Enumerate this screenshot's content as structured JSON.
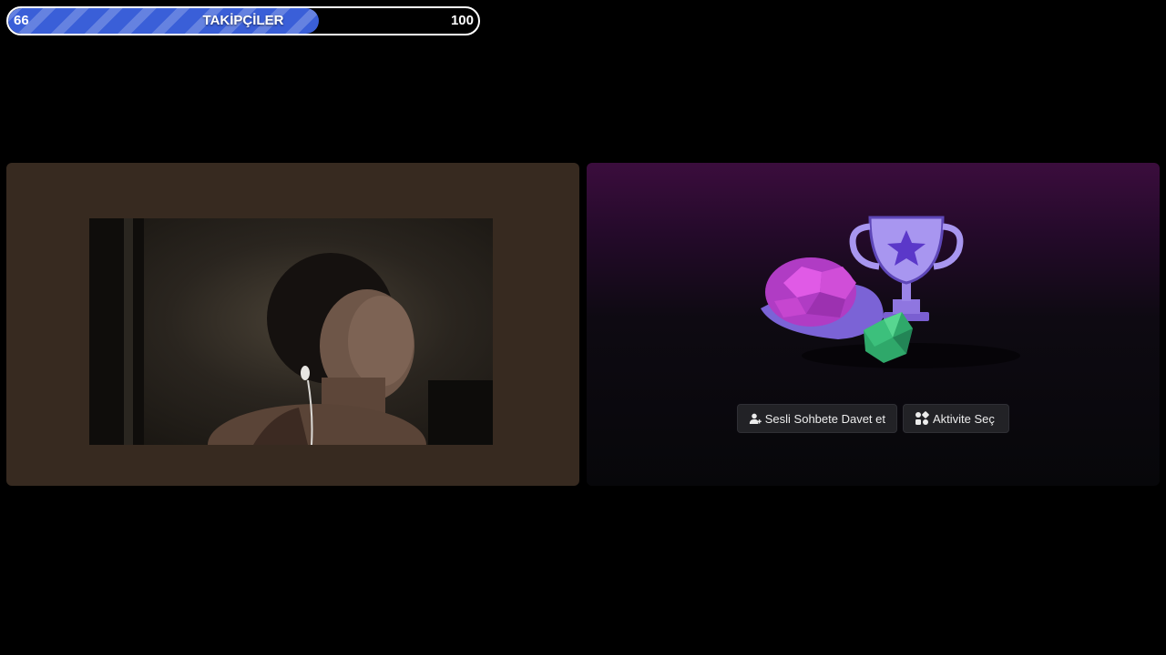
{
  "follower_goal": {
    "current": "66",
    "title": "TAKİPÇİLER",
    "goal": "100",
    "progress_fraction": 0.66,
    "fill_color": "#3a5fd8"
  },
  "call": {
    "participant_tile": {
      "background_color": "#372a20"
    },
    "activity_tile": {
      "invite_button_label": "Sesli Sohbete Davet et",
      "invite_icon": "add-user-icon",
      "activity_button_label": "Aktivite Seç",
      "activity_icon": "activities-icon"
    }
  }
}
